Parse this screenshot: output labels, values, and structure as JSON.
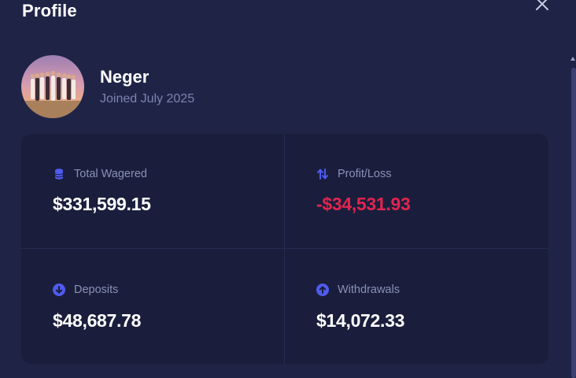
{
  "header": {
    "title": "Profile",
    "close_icon": "close-icon"
  },
  "user": {
    "name": "Neger",
    "joined": "Joined July 2025",
    "avatar": "group-photo-avatar"
  },
  "stats": [
    {
      "id": "total-wagered",
      "icon": "coin-stack-icon",
      "label": "Total Wagered",
      "value": "$331,599.15",
      "color": "#ffffff"
    },
    {
      "id": "profit-loss",
      "icon": "arrows-up-down-icon",
      "label": "Profit/Loss",
      "value": "-$34,531.93",
      "color": "#e0254f"
    },
    {
      "id": "deposits",
      "icon": "arrow-down-circle-icon",
      "label": "Deposits",
      "value": "$48,687.78",
      "color": "#ffffff"
    },
    {
      "id": "withdrawals",
      "icon": "arrow-up-circle-icon",
      "label": "Withdrawals",
      "value": "$14,072.33",
      "color": "#ffffff"
    }
  ],
  "colors": {
    "background": "#1f2447",
    "card": "#1a1e3c",
    "accent": "#4f5bef",
    "muted": "#7c83b0",
    "negative": "#e0254f"
  }
}
